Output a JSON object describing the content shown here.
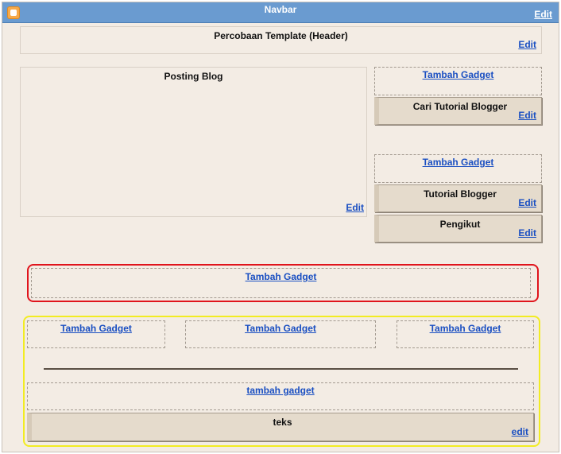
{
  "navbar": {
    "title": "Navbar",
    "edit": "Edit"
  },
  "header": {
    "title": "Percobaan Template (Header)",
    "edit": "Edit"
  },
  "main": {
    "title": "Posting Blog",
    "edit": "Edit"
  },
  "sidebar": {
    "add_gadget_1": "Tambah Gadget",
    "widget_1": {
      "title": "Cari Tutorial Blogger",
      "edit": "Edit"
    },
    "add_gadget_2": "Tambah Gadget",
    "widget_2": {
      "title": "Tutorial Blogger",
      "edit": "Edit"
    },
    "widget_3": {
      "title": "Pengikut",
      "edit": "Edit"
    }
  },
  "red_section": {
    "add_gadget": "Tambah Gadget",
    "border_color": "#e0141c"
  },
  "footer": {
    "columns": [
      "Tambah Gadget",
      "Tambah Gadget",
      "Tambah Gadget"
    ],
    "add_gadget_lower": "tambah gadget",
    "widget": {
      "title": "teks",
      "edit": "edit"
    },
    "border_color": "#f2ec22"
  },
  "colors": {
    "link": "#1a4fc2",
    "navbar": "#6a9bd0",
    "background": "#f3ece4"
  }
}
